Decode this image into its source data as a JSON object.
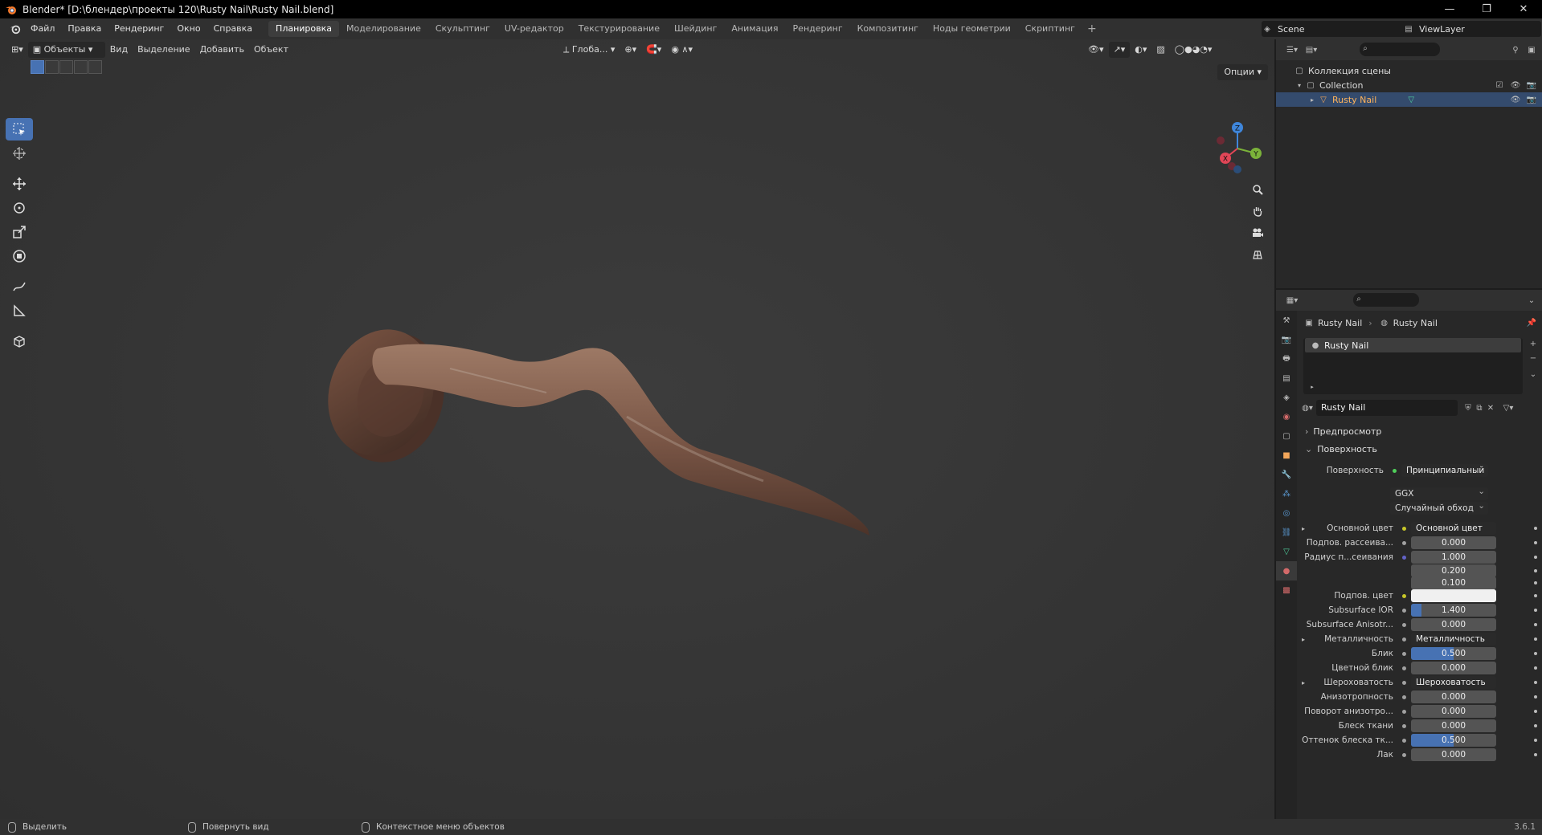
{
  "window": {
    "title": "Blender* [D:\\блендер\\проекты 120\\Rusty Nail\\Rusty Nail.blend]",
    "minimize": "—",
    "maximize": "❐",
    "close": "✕"
  },
  "menubar": {
    "items": [
      "Файл",
      "Правка",
      "Рендеринг",
      "Окно",
      "Справка"
    ],
    "workspaces": [
      "Планировка",
      "Моделирование",
      "Скульптинг",
      "UV-редактор",
      "Текстурирование",
      "Шейдинг",
      "Анимация",
      "Рендеринг",
      "Композитинг",
      "Ноды геометрии",
      "Скриптинг"
    ],
    "active_workspace": "Планировка",
    "add_workspace": "+",
    "scene": "Scene",
    "view_layer": "ViewLayer"
  },
  "viewport": {
    "mode": "Объекты",
    "menus": [
      "Вид",
      "Выделение",
      "Добавить",
      "Объект"
    ],
    "transform_orientation": "Глоба...",
    "options": "Опции",
    "gizmo_axes": {
      "x": "X",
      "y": "Y",
      "z": "Z"
    },
    "colors": {
      "x": "#e24657",
      "y": "#7bb23a",
      "z": "#3f86db"
    }
  },
  "outliner": {
    "scene_collection": "Коллекция сцены",
    "collection": "Collection",
    "object": "Rusty Nail"
  },
  "properties": {
    "breadcrumb_object": "Rusty Nail",
    "breadcrumb_material": "Rusty Nail",
    "material_slot": "Rusty Nail",
    "material_name": "Rusty Nail",
    "preview_panel": "Предпросмотр",
    "surface_panel": "Поверхность",
    "surface_label": "Поверхность",
    "surface_shader": "Принципиальный BSDF",
    "distribution": "GGX",
    "subsurface_method": "Случайный обход",
    "rows": [
      {
        "label": "Основной цвет",
        "value": "Основной цвет",
        "kind": "link",
        "expander": true,
        "socket": "#c7c729"
      },
      {
        "label": "Подпов. рассеива...",
        "value": "0.000",
        "kind": "num",
        "fill": 0,
        "socket": "#a1a1a1"
      },
      {
        "label": "Радиус п...сеивания",
        "value": "1.000",
        "kind": "num",
        "fill": 0,
        "socket": "#6363c7"
      },
      {
        "label": "",
        "value": "0.200",
        "kind": "num",
        "fill": 0,
        "socket": ""
      },
      {
        "label": "",
        "value": "0.100",
        "kind": "num",
        "fill": 0,
        "socket": ""
      },
      {
        "label": "Подпов. цвет",
        "value": "",
        "kind": "color",
        "fill": 0,
        "socket": "#c7c729"
      },
      {
        "label": "Subsurface IOR",
        "value": "1.400",
        "kind": "num",
        "fill": 0.12,
        "socket": "#a1a1a1"
      },
      {
        "label": "Subsurface Anisotr...",
        "value": "0.000",
        "kind": "num",
        "fill": 0,
        "socket": "#a1a1a1"
      },
      {
        "label": "Металличность",
        "value": "Металличность",
        "kind": "link",
        "expander": true,
        "socket": "#a1a1a1"
      },
      {
        "label": "Блик",
        "value": "0.500",
        "kind": "num",
        "fill": 0.5,
        "socket": "#a1a1a1"
      },
      {
        "label": "Цветной блик",
        "value": "0.000",
        "kind": "num",
        "fill": 0,
        "socket": "#a1a1a1"
      },
      {
        "label": "Шероховатость",
        "value": "Шероховатость",
        "kind": "link",
        "expander": true,
        "socket": "#a1a1a1"
      },
      {
        "label": "Анизотропность",
        "value": "0.000",
        "kind": "num",
        "fill": 0,
        "socket": "#a1a1a1"
      },
      {
        "label": "Поворот анизотро...",
        "value": "0.000",
        "kind": "num",
        "fill": 0,
        "socket": "#a1a1a1"
      },
      {
        "label": "Блеск ткани",
        "value": "0.000",
        "kind": "num",
        "fill": 0,
        "socket": "#a1a1a1"
      },
      {
        "label": "Оттенок блеска тк...",
        "value": "0.500",
        "kind": "num",
        "fill": 0.5,
        "socket": "#a1a1a1"
      },
      {
        "label": "Лак",
        "value": "0.000",
        "kind": "num",
        "fill": 0,
        "socket": "#a1a1a1"
      }
    ]
  },
  "statusbar": {
    "select": "Выделить",
    "rotate": "Повернуть вид",
    "context": "Контекстное меню объектов",
    "version": "3.6.1"
  }
}
